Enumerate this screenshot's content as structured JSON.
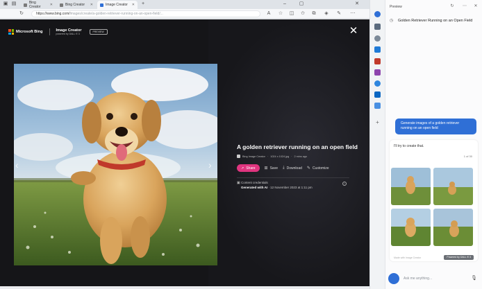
{
  "browser": {
    "tabs": [
      {
        "label": "Bing Creator",
        "active": false
      },
      {
        "label": "Bing Creator",
        "active": false
      },
      {
        "label": "Image Creator",
        "active": true
      }
    ],
    "url_prefix": "https://www.bing.com/",
    "url_rest": "images/create/a-golden-retriever-running-on-an-open-field/..."
  },
  "modal": {
    "brand": "Microsoft Bing",
    "product": "Image Creator",
    "product_sub": "powered by DALL·E 3",
    "badge": "PREVIEW",
    "image_title": "A golden retriever running on an open field",
    "meta": {
      "source": "Bing Image Creator",
      "size": "1024 x 1024 jpg",
      "age": "2 mins ago"
    },
    "actions": {
      "share": "Share",
      "save": "Save",
      "download": "Download",
      "customize": "Customize"
    },
    "credentials": {
      "heading": "Content credentials",
      "generated": "Generated with AI",
      "date": "12 November 2023 at 1:11 pm"
    }
  },
  "pane": {
    "label": "Preview",
    "title": "Golden Retriever Running on an Open Field",
    "user_message": "Generate images of a golden retriever running on an open field",
    "bot_text": "I'll try to create that.",
    "page_indicator": "1 of 30",
    "footer": "Made with Image Creator",
    "dalle_badge": "Powered by DALL·E 3",
    "chat_placeholder": "Ask me anything..."
  },
  "colors": {
    "share": "#e0357f",
    "user_bubble": "#2f6fd6",
    "modal_bg": "#151518"
  }
}
